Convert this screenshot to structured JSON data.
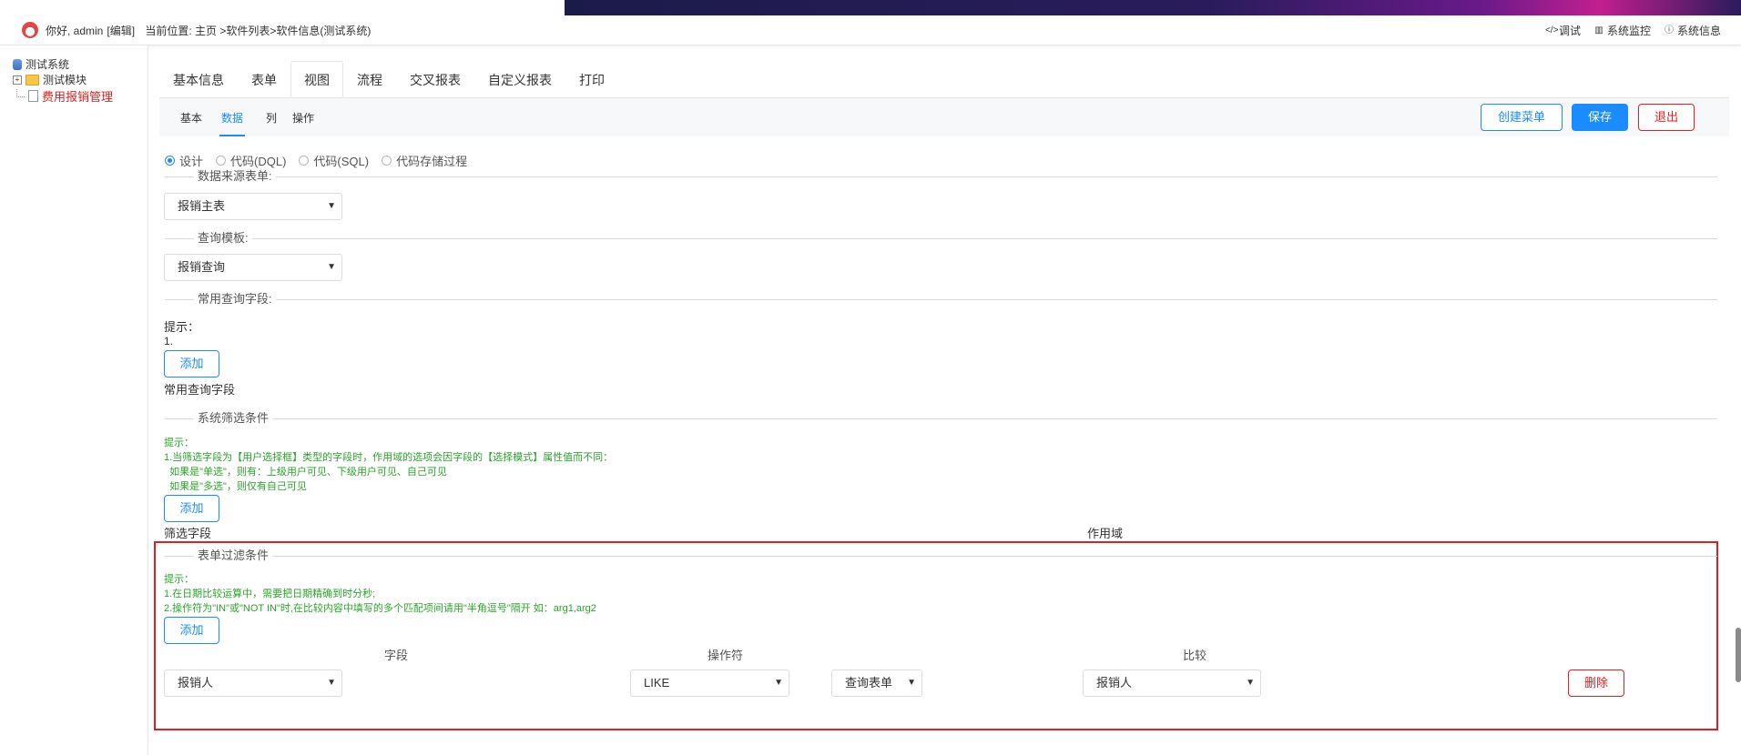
{
  "topbar": {
    "greeting": "你好, admin",
    "edit_link": "[编辑]",
    "location": "当前位置: 主页 >软件列表>软件信息(测试系统)",
    "tools": [
      {
        "label": "调试",
        "icon": "code-icon"
      },
      {
        "label": "系统监控",
        "icon": "monitor-icon"
      },
      {
        "label": "系统信息",
        "icon": "info-icon"
      }
    ]
  },
  "sidebar": {
    "root": "测试系统",
    "module": "测试模块",
    "leaf": "费用报销管理"
  },
  "tabs": [
    "基本信息",
    "表单",
    "视图",
    "流程",
    "交叉报表",
    "自定义报表",
    "打印"
  ],
  "active_tab": "视图",
  "subtabs": [
    "基本",
    "数据",
    "列",
    "操作"
  ],
  "active_subtab": "数据",
  "actions": {
    "create_menu": "创建菜单",
    "save": "保存",
    "exit": "退出"
  },
  "modes": [
    {
      "label": "设计",
      "checked": true
    },
    {
      "label": "代码(DQL)",
      "checked": false
    },
    {
      "label": "代码(SQL)",
      "checked": false
    },
    {
      "label": "代码存储过程",
      "checked": false
    }
  ],
  "sections": {
    "data_source": {
      "legend": "数据来源表单:",
      "value": "报销主表"
    },
    "query_template": {
      "legend": "查询模板:",
      "value": "报销查询"
    },
    "common_fields": {
      "legend": "常用查询字段:",
      "tip_title": "提示：",
      "tip_1": "1.",
      "add": "添加",
      "label": "常用查询字段"
    },
    "system_filter": {
      "legend": "系统筛选条件",
      "tip_title": "提示：",
      "tip_lines": [
        "1.当筛选字段为【用户选择框】类型的字段时，作用域的选项会因字段的【选择模式】属性值而不同：",
        "  如果是\"单选\"，则有：上级用户可见、下级用户可见、自己可见",
        "  如果是\"多选\"，则仅有自己可见"
      ],
      "add": "添加",
      "col_field": "筛选字段",
      "col_scope": "作用域"
    },
    "form_filter": {
      "legend": "表单过滤条件",
      "tip_title": "提示：",
      "tip_lines": [
        "1.在日期比较运算中，需要把日期精确到时分秒;",
        "2.操作符为\"IN\"或\"NOT IN\"时,在比较内容中填写的多个匹配项间请用\"半角逗号\"隔开 如：arg1,arg2"
      ],
      "add": "添加",
      "col_field": "字段",
      "col_operator": "操作符",
      "col_compare": "比较",
      "row": {
        "field": "报销人",
        "operator": "LIKE",
        "source": "查询表单",
        "compare": "报销人",
        "delete": "删除"
      }
    }
  },
  "colors": {
    "accent": "#1a8cff",
    "danger": "#e02020",
    "tip": "#2aa52a"
  }
}
